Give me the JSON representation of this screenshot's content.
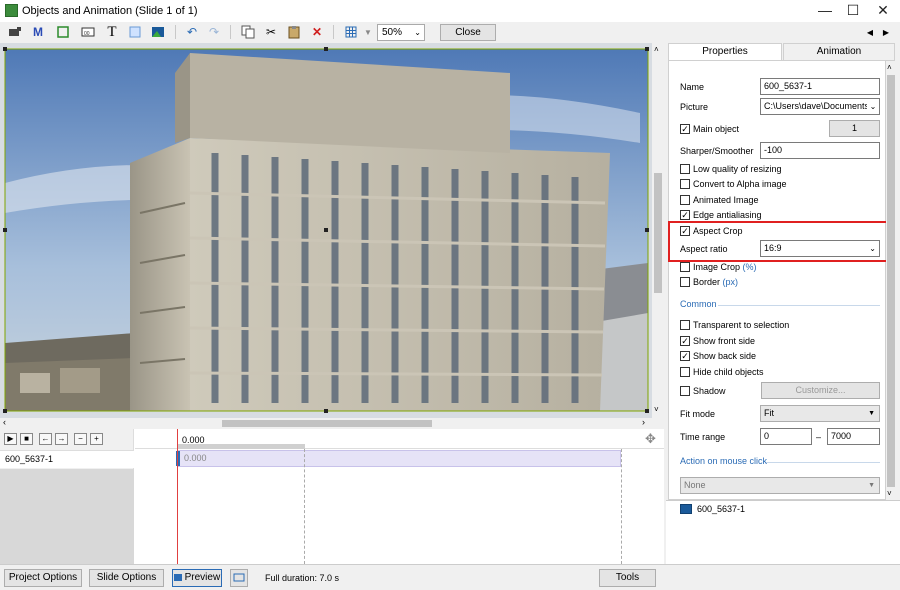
{
  "window": {
    "title": "Objects and Animation (Slide 1 of 1)",
    "minimize": "—",
    "maximize": "☐",
    "close": "✕"
  },
  "toolbar": {
    "zoom_value": "50%",
    "close_label": "Close",
    "icons": [
      "camera-icon",
      "m-text-icon",
      "frame-icon",
      "counter-icon",
      "text-icon",
      "rectangle-icon",
      "image-icon",
      "undo-icon",
      "redo-icon",
      "copy-icon",
      "cut-icon",
      "paste-icon",
      "delete-icon",
      "grid-icon"
    ],
    "nav_prev": "◀",
    "nav_next": "▶"
  },
  "tabs": {
    "properties": "Properties",
    "animation": "Animation"
  },
  "properties": {
    "name_label": "Name",
    "name_value": "600_5637-1",
    "picture_label": "Picture",
    "picture_value": "C:\\Users\\dave\\Documents\\Ir",
    "main_object_label": "Main object",
    "main_object_checked": true,
    "main_object_number": "1",
    "sharper_label": "Sharper/Smoother",
    "sharper_value": "-100",
    "low_quality_label": "Low quality of resizing",
    "convert_alpha_label": "Convert to Alpha image",
    "animated_image_label": "Animated Image",
    "edge_aa_label": "Edge antialiasing",
    "aspect_crop_label": "Aspect Crop",
    "aspect_ratio_label": "Aspect ratio",
    "aspect_ratio_value": "16:9",
    "image_crop_label": "Image Crop",
    "image_crop_unit": "(%)",
    "border_label": "Border",
    "border_unit": "(px)",
    "common_section": "Common",
    "transparent_label": "Transparent to selection",
    "show_front_label": "Show front side",
    "show_back_label": "Show back side",
    "hide_child_label": "Hide child objects",
    "shadow_label": "Shadow",
    "customize_label": "Customize...",
    "fit_mode_label": "Fit mode",
    "fit_mode_value": "Fit",
    "time_range_label": "Time range",
    "time_start": "0",
    "time_dash": "–",
    "time_end": "7000",
    "action_section": "Action on mouse click",
    "action_value": "None",
    "object_list_item": "600_5637-1"
  },
  "timeline": {
    "time_marker": "0.000",
    "track_name": "600_5637-1",
    "clip_time": "0.000"
  },
  "bottom": {
    "project_options": "Project Options",
    "slide_options": "Slide Options",
    "preview": "Preview",
    "full_duration": "Full duration: 7.0 s",
    "tools": "Tools"
  },
  "colors": {
    "highlight_border": "#e02020",
    "selection_frame": "#7fa400",
    "link_blue": "#2a6bb5",
    "playhead": "#e04040"
  }
}
